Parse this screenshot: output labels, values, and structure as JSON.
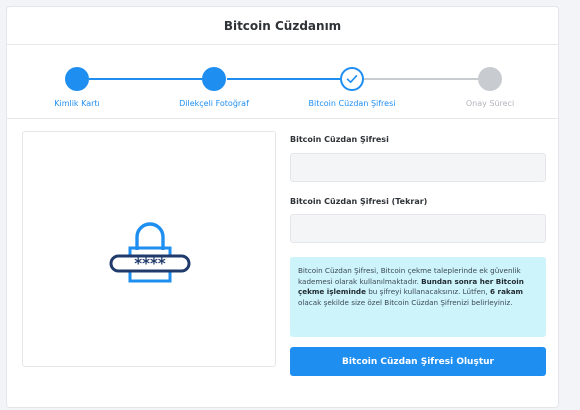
{
  "header": {
    "title": "Bitcoin Cüzdanım"
  },
  "steps": [
    {
      "label": "Kimlik Kartı",
      "state": "done"
    },
    {
      "label": "Dilekçeli Fotoğraf",
      "state": "done"
    },
    {
      "label": "Bitcoin Cüzdan Şifresi",
      "state": "active"
    },
    {
      "label": "Onay Süreci",
      "state": "pending"
    }
  ],
  "illustration": {
    "icon": "lock-password-icon",
    "mask": "****"
  },
  "form": {
    "password_label": "Bitcoin Cüzdan Şifresi",
    "password_value": "",
    "password_repeat_label": "Bitcoin Cüzdan Şifresi (Tekrar)",
    "password_repeat_value": ""
  },
  "info": {
    "p1": "Bitcoin Cüzdan Şifresi, Bitcoin çekme taleplerinde ek güvenlik kademesi olarak kullanılmaktadır. ",
    "b1": "Bundan sonra her Bitcoin çekme işleminde",
    "p2": " bu şifreyi kullanacaksınız. Lütfen, ",
    "b2": "6 rakam",
    "p3": " olacak şekilde size özel Bitcoin Cüzdan Şifrenizi belirleyiniz."
  },
  "submit_label": "Bitcoin Cüzdan Şifresi Oluştur",
  "colors": {
    "accent": "#1f8ef1",
    "pending": "#c8cbd0",
    "info_bg": "#cdf3fb"
  }
}
